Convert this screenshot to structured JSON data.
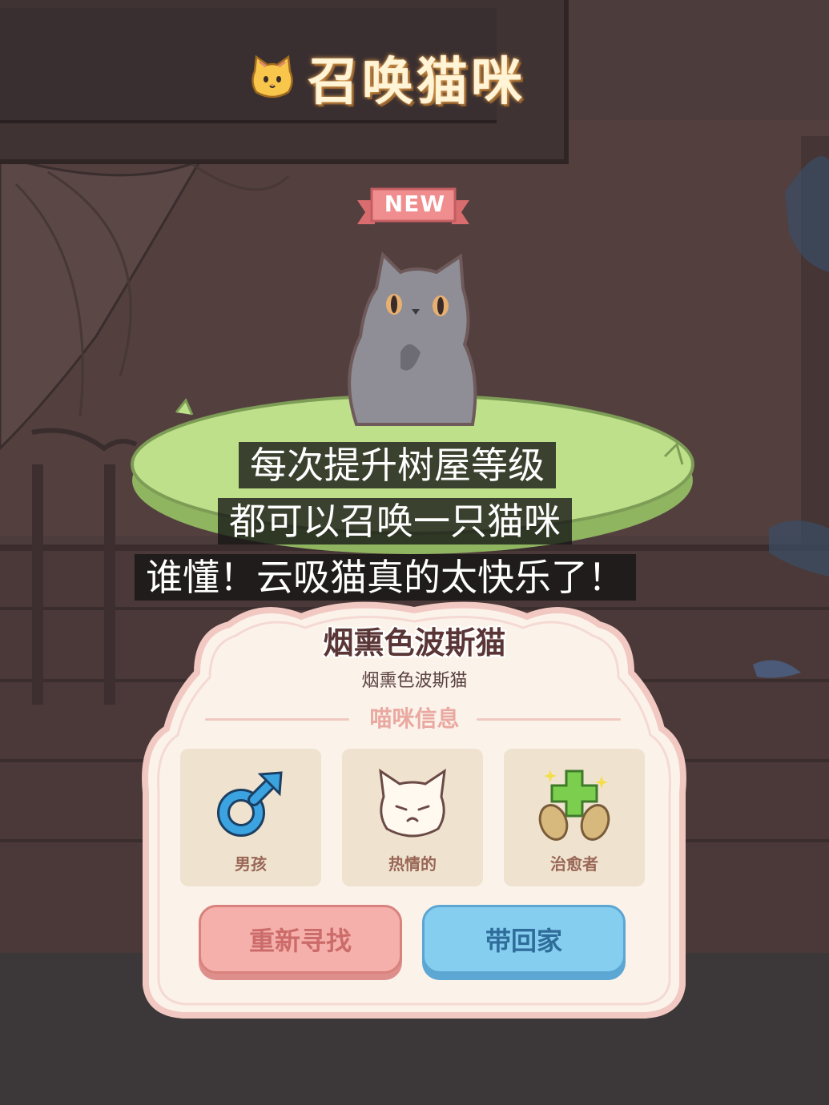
{
  "header": {
    "title": "召唤猫咪",
    "title_icon": "cat-face-icon"
  },
  "badge": {
    "label": "NEW"
  },
  "subtitles": {
    "line1": "每次提升树屋等级",
    "line2": "都可以召唤一只猫咪",
    "line3": "谁懂！云吸猫真的太快乐了！"
  },
  "cat": {
    "name": "烟熏色波斯猫",
    "breed": "烟熏色波斯猫",
    "section_title": "喵咪信息",
    "traits": [
      {
        "icon": "male-symbol-icon",
        "label": "男孩"
      },
      {
        "icon": "cat-face-icon",
        "label": "热情的"
      },
      {
        "icon": "healer-paws-icon",
        "label": "治愈者"
      }
    ]
  },
  "buttons": {
    "retry": "重新寻找",
    "take_home": "带回家"
  },
  "colors": {
    "retry_button": "#f5b0ac",
    "take_home_button": "#86cef0",
    "panel_background": "#fbf3ea",
    "grass": "#bfe08a"
  }
}
